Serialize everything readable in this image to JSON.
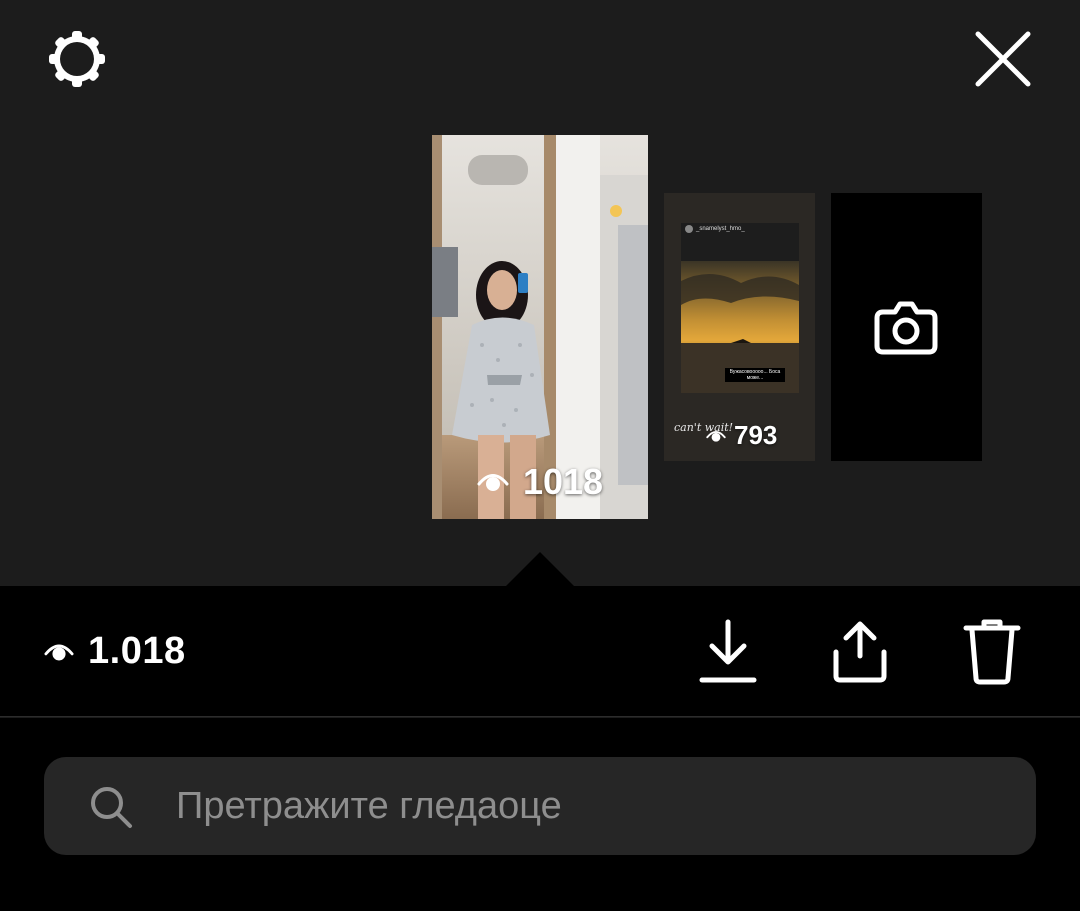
{
  "header": {
    "settings_icon": "gear-icon",
    "close_icon": "close-icon"
  },
  "stories": [
    {
      "views": "1018",
      "selected": true,
      "view_icon": "eye-icon"
    },
    {
      "views": "793",
      "selected": false,
      "view_icon": "eye-icon",
      "inner_username": "_snamelyst_hmo_",
      "caption": "Вужасовооооо... Боса може...",
      "script_text": "can't wait!"
    }
  ],
  "add_story": {
    "icon": "camera-icon"
  },
  "selected_story": {
    "views_total": "1.018",
    "view_icon": "eye-icon"
  },
  "actions": {
    "download_icon": "download-icon",
    "share_icon": "share-icon",
    "delete_icon": "trash-icon"
  },
  "search": {
    "placeholder": "Претражите гледаоце",
    "value": "",
    "icon": "search-icon"
  },
  "colors": {
    "background_top": "#1c1c1c",
    "background_bottom": "#000000",
    "search_bg": "#262626",
    "placeholder": "#8e8e8e",
    "text": "#ffffff"
  }
}
